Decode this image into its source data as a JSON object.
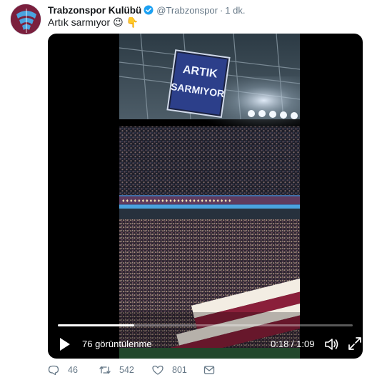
{
  "tweet": {
    "display_name": "Trabzonspor Kulübü",
    "handle": "@Trabzonspor",
    "separator": "·",
    "time": "1 dk.",
    "text": "Artık sarmıyor",
    "emojis": [
      "😉",
      "👇"
    ]
  },
  "video": {
    "views_label": "76 görüntülenme",
    "duration_label": "0:18 / 1:09",
    "progress": 0.26,
    "scoreboard_text": [
      "ARTIK",
      "SARMIYOR"
    ]
  },
  "actions": {
    "reply_count": "46",
    "retweet_count": "542",
    "like_count": "801"
  },
  "colors": {
    "club_maroon": "#7a1f3d",
    "club_blue": "#4aa3df",
    "verified_blue": "#1da1f2",
    "muted_text": "#657786"
  },
  "icons": {
    "reply": "reply-icon",
    "retweet": "retweet-icon",
    "like": "heart-icon",
    "dm": "envelope-icon",
    "play": "play-icon",
    "volume": "volume-icon",
    "fullscreen": "fullscreen-icon",
    "verified": "verified-badge-icon"
  }
}
